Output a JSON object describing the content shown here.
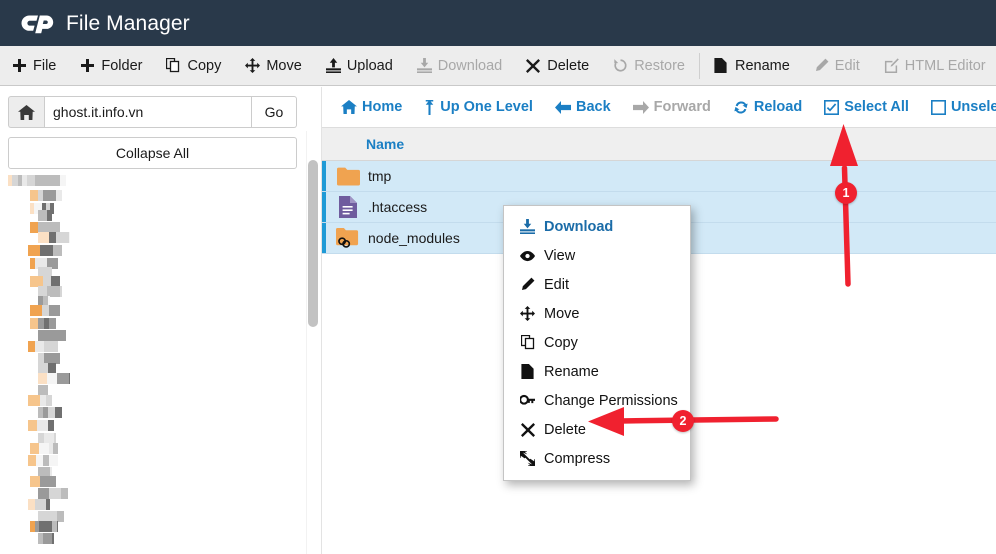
{
  "header": {
    "title": "File Manager",
    "logo_icon": "cpanel-logo-icon"
  },
  "toolbar": {
    "items": [
      {
        "label": "File",
        "icon": "plus-icon",
        "disabled": false
      },
      {
        "label": "Folder",
        "icon": "plus-icon",
        "disabled": false
      },
      {
        "label": "Copy",
        "icon": "copy-icon",
        "disabled": false
      },
      {
        "label": "Move",
        "icon": "move-icon",
        "disabled": false
      },
      {
        "label": "Upload",
        "icon": "upload-icon",
        "disabled": false
      },
      {
        "label": "Download",
        "icon": "download-icon",
        "disabled": true
      },
      {
        "label": "Delete",
        "icon": "x-icon",
        "disabled": false
      },
      {
        "label": "Restore",
        "icon": "restore-icon",
        "disabled": true
      },
      {
        "label": "Rename",
        "icon": "file-icon",
        "disabled": false
      },
      {
        "label": "Edit",
        "icon": "pencil-icon",
        "disabled": true
      },
      {
        "label": "HTML Editor",
        "icon": "html-editor-icon",
        "disabled": true
      },
      {
        "label": "",
        "icon": "key-icon",
        "disabled": false
      }
    ]
  },
  "sidebar": {
    "home_icon": "home-icon",
    "path_value": "ghost.it.info.vn",
    "path_placeholder": "",
    "go_label": "Go",
    "collapse_label": "Collapse All",
    "tree_note": "directory tree (pixelated / redacted)"
  },
  "navbar": {
    "items": [
      {
        "label": "Home",
        "icon": "home-icon",
        "disabled": false
      },
      {
        "label": "Up One Level",
        "icon": "up-arrow-icon",
        "disabled": false
      },
      {
        "label": "Back",
        "icon": "arrow-left-icon",
        "disabled": false
      },
      {
        "label": "Forward",
        "icon": "arrow-right-icon",
        "disabled": true
      },
      {
        "label": "Reload",
        "icon": "reload-icon",
        "disabled": false
      },
      {
        "label": "Select All",
        "icon": "checkbox-checked-icon",
        "disabled": false
      },
      {
        "label": "Unselect All",
        "icon": "checkbox-empty-icon",
        "disabled": false
      }
    ]
  },
  "file_table": {
    "columns": [
      "Name"
    ],
    "rows": [
      {
        "name": "tmp",
        "icon": "folder-icon",
        "selected": true
      },
      {
        "name": ".htaccess",
        "icon": "document-icon",
        "selected": true
      },
      {
        "name": "node_modules",
        "icon": "folder-symlink-icon",
        "selected": true
      }
    ]
  },
  "context_menu": {
    "items": [
      {
        "label": "Download",
        "icon": "download-icon",
        "active": true
      },
      {
        "label": "View",
        "icon": "eye-icon",
        "active": false
      },
      {
        "label": "Edit",
        "icon": "pencil-icon",
        "active": false
      },
      {
        "label": "Move",
        "icon": "move-icon",
        "active": false
      },
      {
        "label": "Copy",
        "icon": "copy-icon",
        "active": false
      },
      {
        "label": "Rename",
        "icon": "file-icon",
        "active": false
      },
      {
        "label": "Change Permissions",
        "icon": "key-icon",
        "active": false
      },
      {
        "label": "Delete",
        "icon": "x-icon",
        "active": false
      },
      {
        "label": "Compress",
        "icon": "compress-icon",
        "active": false
      }
    ]
  },
  "annotations": {
    "color": "#f0212f",
    "markers": [
      {
        "label": "1",
        "points_to": "Select All"
      },
      {
        "label": "2",
        "points_to": "Delete"
      }
    ]
  },
  "colors": {
    "header_bg": "#29394a",
    "toolbar_bg": "#ededed",
    "link_blue": "#1b7fc4",
    "row_selected_bg": "#d2e9f7",
    "row_select_bar": "#1e9ad6",
    "folder_orange": "#f0a350",
    "document_purple": "#6f5c9e",
    "annotation_red": "#f0212f"
  }
}
